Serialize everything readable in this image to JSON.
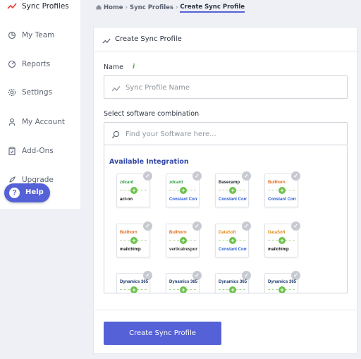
{
  "sidebar": {
    "items": [
      {
        "label": "Sync Profiles",
        "icon": "trend-line-icon",
        "active": true
      },
      {
        "label": "My Team",
        "icon": "pie-chart-icon"
      },
      {
        "label": "Reports",
        "icon": "chart-circle-icon"
      },
      {
        "label": "Settings",
        "icon": "gear-icon"
      },
      {
        "label": "My Account",
        "icon": "user-icon"
      },
      {
        "label": "Add-Ons",
        "icon": "clipboard-icon"
      },
      {
        "label": "Upgrade",
        "icon": "rocket-icon"
      }
    ],
    "help_label": "Help"
  },
  "breadcrumb": {
    "home": "Home",
    "parent": "Sync Profiles",
    "current": "Create Sync Profile",
    "separator": "›"
  },
  "card": {
    "title": "Create Sync Profile",
    "name_label": "Name",
    "name_info": "i",
    "name_placeholder": "Sync Profile Name",
    "software_label": "Select software combination",
    "search_placeholder": "Find your Software here...",
    "integration_heading": "Available Integration",
    "submit_label": "Create Sync Profile"
  },
  "integrations": [
    {
      "top": "zdcard",
      "bottom": "act-on",
      "top_color": "#2f9a43",
      "bottom_color": "#111"
    },
    {
      "top": "zdcard",
      "bottom": "Constant Contact",
      "top_color": "#2f9a43",
      "bottom_color": "#2a5bd7"
    },
    {
      "top": "Basecamp",
      "bottom": "Constant Contact",
      "top_color": "#1e2430",
      "bottom_color": "#2a5bd7"
    },
    {
      "top": "Bullhorn",
      "bottom": "Constant Contact",
      "top_color": "#e06a1c",
      "bottom_color": "#2a5bd7"
    },
    {
      "top": "Bullhorn",
      "bottom": "mailchimp",
      "top_color": "#e06a1c",
      "bottom_color": "#111"
    },
    {
      "top": "Bullhorn",
      "bottom": "verticalresponse",
      "top_color": "#e06a1c",
      "bottom_color": "#333"
    },
    {
      "top": "DataSoft",
      "bottom": "Constant Contact",
      "top_color": "#e08a1c",
      "bottom_color": "#2a5bd7"
    },
    {
      "top": "DataSoft",
      "bottom": "mailchimp",
      "top_color": "#e08a1c",
      "bottom_color": "#111"
    },
    {
      "top": "Dynamics 365",
      "bottom": "",
      "top_color": "#1c3a6e",
      "bottom_color": "#111"
    },
    {
      "top": "Dynamics 365",
      "bottom": "",
      "top_color": "#1c3a6e",
      "bottom_color": "#111"
    },
    {
      "top": "Dynamics 365",
      "bottom": "",
      "top_color": "#1c3a6e",
      "bottom_color": "#111"
    },
    {
      "top": "Dynamics 365",
      "bottom": "",
      "top_color": "#1c3a6e",
      "bottom_color": "#111"
    }
  ],
  "colors": {
    "accent": "#5561d6",
    "active_icon": "#e0392b",
    "info_green": "#55b23a",
    "heading_blue": "#3448a8"
  }
}
